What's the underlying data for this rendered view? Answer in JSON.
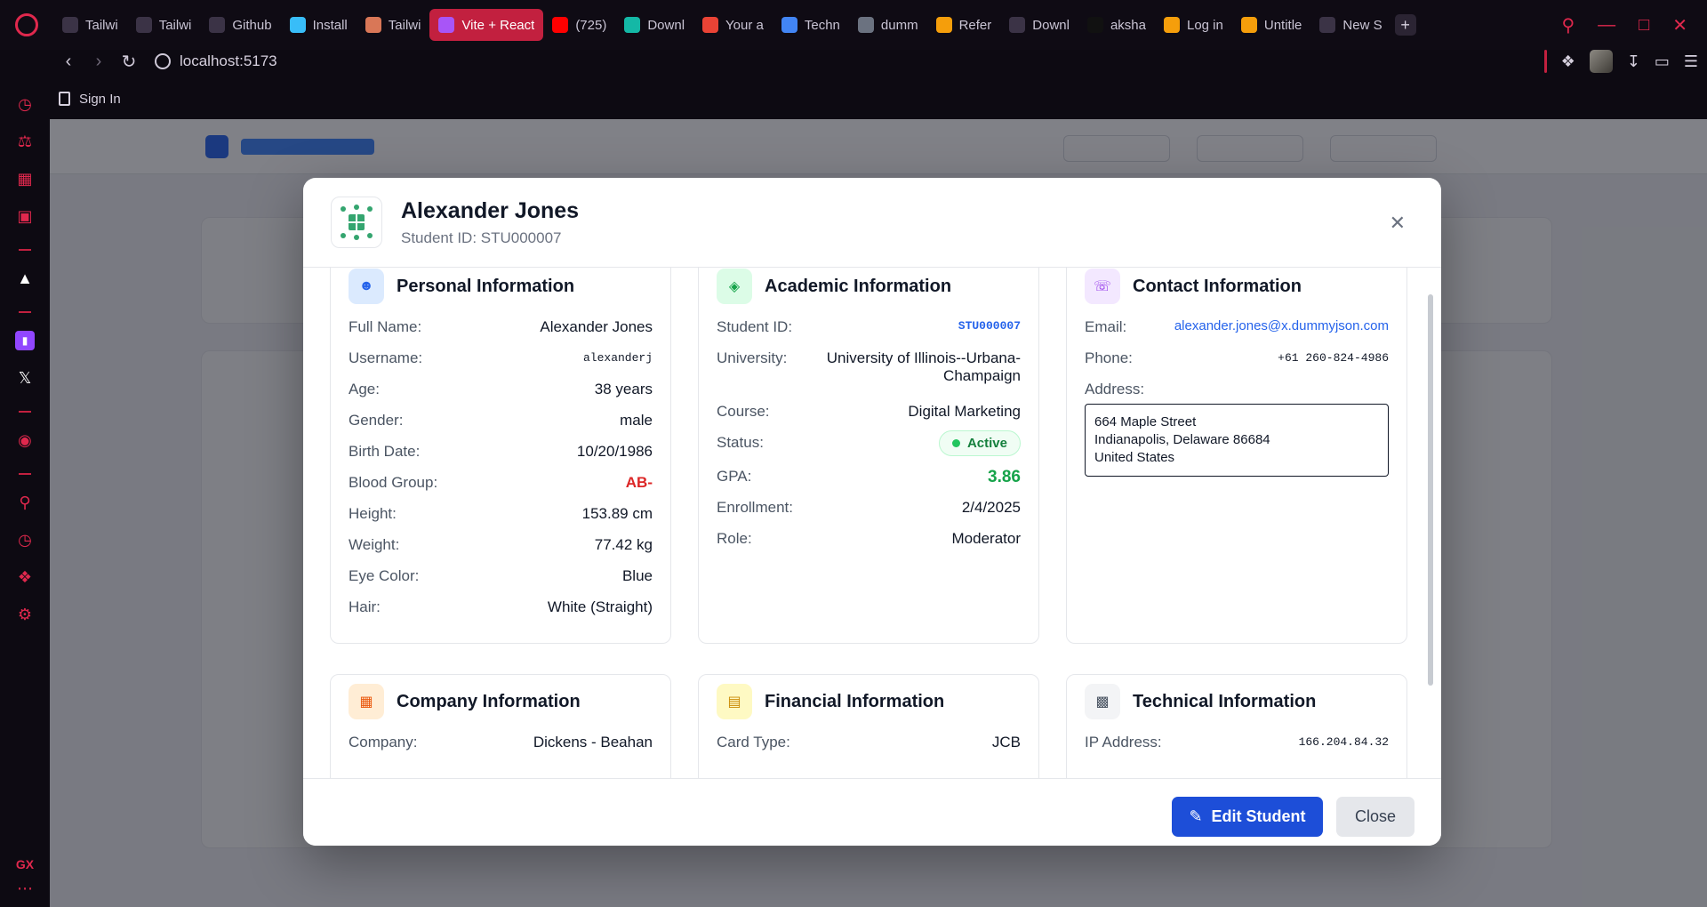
{
  "browser": {
    "tabs": [
      {
        "label": "Tailwi",
        "icon": "gamepad-icon",
        "color": "#3b3346"
      },
      {
        "label": "Tailwi",
        "icon": "openai-icon",
        "color": "#3b3346"
      },
      {
        "label": "Github",
        "icon": "notion-icon",
        "color": "#3b3346"
      },
      {
        "label": "Install",
        "icon": "tailwind-icon",
        "color": "#38bdf8"
      },
      {
        "label": "Tailwi",
        "icon": "claude-icon",
        "color": "#d97757"
      },
      {
        "label": "Vite + React",
        "icon": "vite-icon",
        "color": "#a855f7",
        "active": true
      },
      {
        "label": "(725)",
        "icon": "youtube-icon",
        "color": "#ff0000"
      },
      {
        "label": "Downl",
        "icon": "bug-icon",
        "color": "#14b8a6"
      },
      {
        "label": "Your a",
        "icon": "gmail-icon",
        "color": "#ea4335"
      },
      {
        "label": "Techn",
        "icon": "docs-icon",
        "color": "#4285f4"
      },
      {
        "label": "dumm",
        "icon": "circle-icon",
        "color": "#6b7280"
      },
      {
        "label": "Refer",
        "icon": "ug-icon",
        "color": "#f59e0b"
      },
      {
        "label": "Downl",
        "icon": "download-icon",
        "color": "#3b3346"
      },
      {
        "label": "aksha",
        "icon": "github-icon",
        "color": "#111"
      },
      {
        "label": "Log in",
        "icon": "ug-icon",
        "color": "#f59e0b"
      },
      {
        "label": "Untitle",
        "icon": "ug-icon",
        "color": "#f59e0b"
      },
      {
        "label": "New S",
        "icon": "globe-icon",
        "color": "#3b3346"
      }
    ],
    "url": "localhost:5173",
    "bookmark": "Sign In",
    "gx_label": "GX"
  },
  "student": {
    "name": "Alexander Jones",
    "subtitle": "Student ID: STU000007"
  },
  "personal": {
    "title": "Personal Information",
    "rows": [
      {
        "k": "Full Name:",
        "v": "Alexander Jones"
      },
      {
        "k": "Username:",
        "v": "alexanderj"
      },
      {
        "k": "Age:",
        "v": "38 years"
      },
      {
        "k": "Gender:",
        "v": "male"
      },
      {
        "k": "Birth Date:",
        "v": "10/20/1986"
      },
      {
        "k": "Blood Group:",
        "v": "AB-"
      },
      {
        "k": "Height:",
        "v": "153.89 cm"
      },
      {
        "k": "Weight:",
        "v": "77.42 kg"
      },
      {
        "k": "Eye Color:",
        "v": "Blue"
      },
      {
        "k": "Hair:",
        "v": "White (Straight)"
      }
    ]
  },
  "academic": {
    "title": "Academic Information",
    "rows": [
      {
        "k": "Student ID:",
        "v": "STU000007"
      },
      {
        "k": "University:",
        "v": "University of Illinois--Urbana-Champaign"
      },
      {
        "k": "Course:",
        "v": "Digital Marketing"
      },
      {
        "k": "Status:",
        "v": "Active"
      },
      {
        "k": "GPA:",
        "v": "3.86"
      },
      {
        "k": "Enrollment:",
        "v": "2/4/2025"
      },
      {
        "k": "Role:",
        "v": "Moderator"
      }
    ]
  },
  "contact": {
    "title": "Contact Information",
    "email_label": "Email:",
    "email": "alexander.jones@x.dummyjson.com",
    "phone_label": "Phone:",
    "phone": "+61 260-824-4986",
    "address_label": "Address:",
    "address_line1": "664 Maple Street",
    "address_line2": "Indianapolis, Delaware 86684",
    "address_line3": "United States"
  },
  "company": {
    "title": "Company Information",
    "rows": [
      {
        "k": "Company:",
        "v": "Dickens - Beahan"
      }
    ]
  },
  "financial": {
    "title": "Financial Information",
    "rows": [
      {
        "k": "Card Type:",
        "v": "JCB"
      }
    ]
  },
  "technical": {
    "title": "Technical Information",
    "rows": [
      {
        "k": "IP Address:",
        "v": "166.204.84.32"
      }
    ]
  },
  "footer": {
    "edit_label": "Edit Student",
    "close_label": "Close"
  },
  "colors": {
    "accent": "#1d4ed8",
    "browser_accent": "#e0284d",
    "active_green": "#16a34a",
    "blood_red": "#dc2626"
  }
}
